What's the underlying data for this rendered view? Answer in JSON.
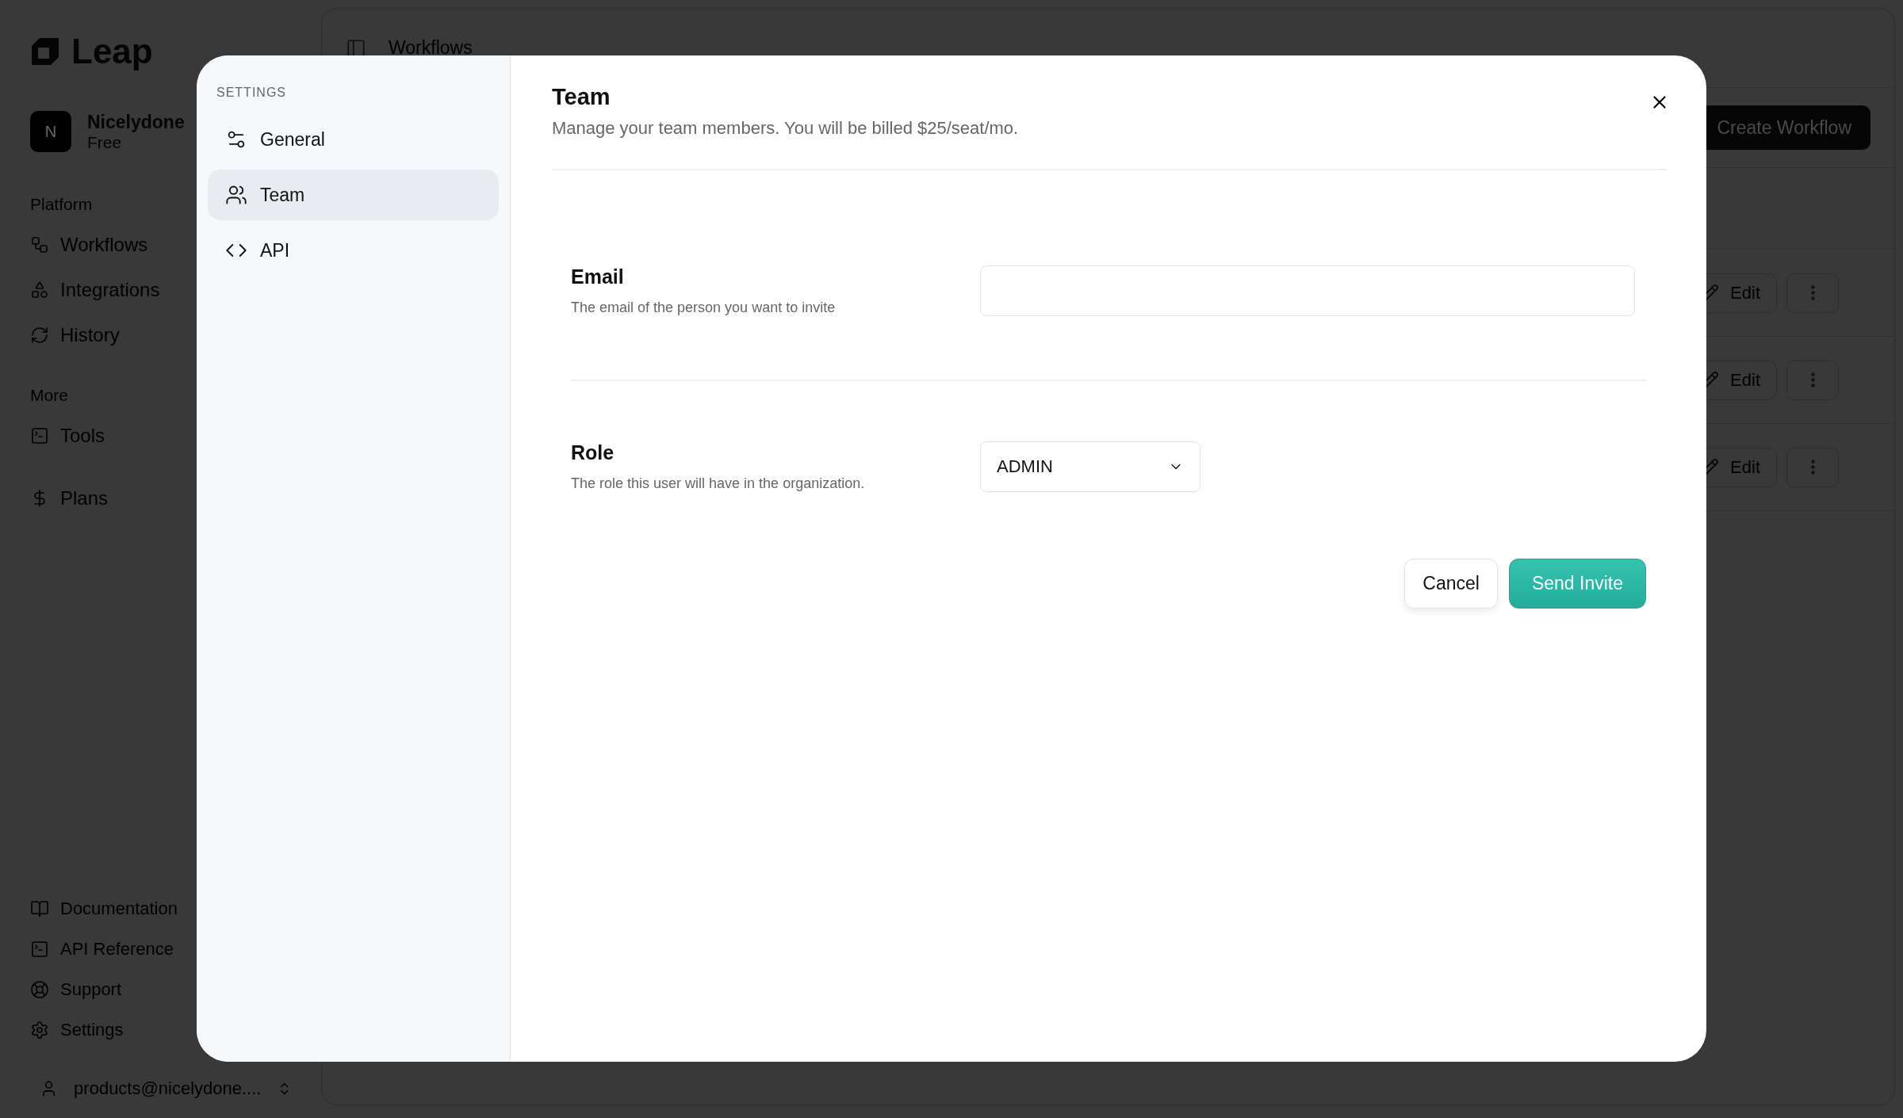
{
  "app": {
    "logo": "Leap",
    "workspace": {
      "initial": "N",
      "name": "Nicelydone",
      "plan": "Free"
    },
    "sidebar_sections": [
      {
        "heading": "Platform",
        "items": [
          {
            "label": "Workflows"
          },
          {
            "label": "Integrations"
          },
          {
            "label": "History"
          }
        ]
      },
      {
        "heading": "More",
        "items": [
          {
            "label": "Tools"
          }
        ]
      },
      {
        "items": [
          {
            "label": "Plans"
          }
        ]
      }
    ],
    "footer_links": [
      {
        "label": "Documentation"
      },
      {
        "label": "API Reference"
      },
      {
        "label": "Support"
      },
      {
        "label": "Settings"
      }
    ],
    "user": "products@nicelydone....",
    "breadcrumb": "Workflows",
    "primary_button": "Create Workflow",
    "rows": [
      {
        "action": "Edit"
      },
      {
        "action": "Edit"
      },
      {
        "action": "Edit"
      }
    ]
  },
  "dialog": {
    "nav_heading": "SETTINGS",
    "nav": [
      {
        "label": "General",
        "selected": false
      },
      {
        "label": "Team",
        "selected": true
      },
      {
        "label": "API",
        "selected": false
      }
    ],
    "title": "Team",
    "subtitle": "Manage your team members. You will be billed $25/seat/mo.",
    "fields": [
      {
        "kind": "input",
        "label": "Email",
        "description": "The email of the person you want to invite"
      },
      {
        "kind": "select",
        "label": "Role",
        "description": "The role this user will have in the organization.",
        "value": "ADMIN"
      }
    ],
    "buttons": [
      {
        "label": "Cancel",
        "kind": "secondary"
      },
      {
        "label": "Send Invite",
        "kind": "primary"
      }
    ]
  }
}
